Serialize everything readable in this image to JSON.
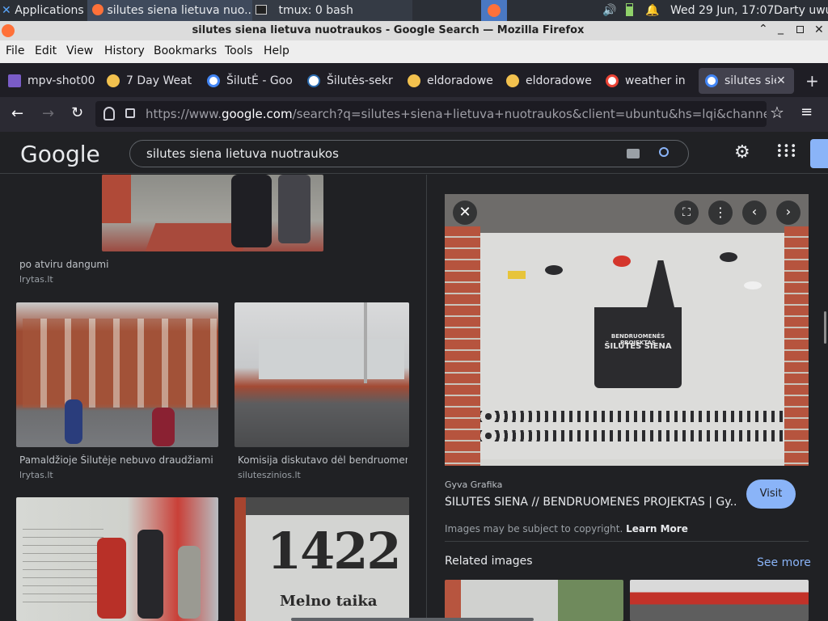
{
  "taskbar": {
    "applications": "Applications",
    "window1": "silutes siena lietuva nuo...",
    "window2": "tmux: 0 bash",
    "datetime": "Wed 29 Jun, 17:07",
    "user": "Darty uwu"
  },
  "window": {
    "title": "silutes siena lietuva nuotraukos - Google Search — Mozilla Firefox"
  },
  "menu": [
    "File",
    "Edit",
    "View",
    "History",
    "Bookmarks",
    "Tools",
    "Help"
  ],
  "tabs": [
    {
      "label": "mpv-shot00"
    },
    {
      "label": "7 Day Weat"
    },
    {
      "label": "ŠilutĖ - Goo"
    },
    {
      "label": "Šilutės-sekr"
    },
    {
      "label": "eldoradowe"
    },
    {
      "label": "eldoradowe"
    },
    {
      "label": "weather in "
    },
    {
      "label": "silutes sie"
    }
  ],
  "url": {
    "prefix": "https://www.",
    "domain": "google.com",
    "rest": "/search?q=silutes+siena+lietuva+nuotraukos&client=ubuntu&hs=lqi&channel=fs&"
  },
  "google": {
    "logo": "Google",
    "query": "silutes siena lietuva nuotraukos"
  },
  "results": [
    {
      "caption": "po atviru dangumi",
      "source": "lrytas.lt"
    },
    {
      "caption": "Pamaldžioje Šilutėje nebuvo draudžiami ...",
      "source": "lrytas.lt"
    },
    {
      "caption": "Komisija diskutavo dėl bendruomen...",
      "source": "siluteszinios.lt"
    }
  ],
  "preview": {
    "image_text_1": "BENDRUOMENĖS PROJEKTAS",
    "image_text_2": "ŠILUTĖS SIENA",
    "site": "Gyva Grafika",
    "title": "ŠILUTĖS SIENA // BENDRUOMENĖS PROJEKTAS | Gy...",
    "visit": "Visit",
    "copyright": "Images may be subject to copyright.",
    "learn_more": "Learn More",
    "related": "Related images",
    "see_more": "See more"
  },
  "art": {
    "year": "1422",
    "subtitle": "Melno taika"
  }
}
